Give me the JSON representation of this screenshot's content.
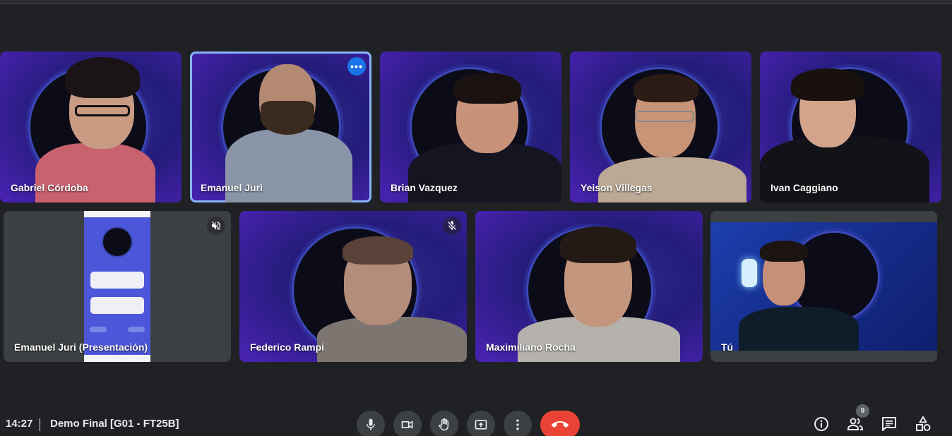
{
  "meeting": {
    "time": "14:27",
    "title": "Demo Final [G01 - FT25B]",
    "participant_count": "9"
  },
  "tiles": [
    {
      "name": "Gabriel Córdoba"
    },
    {
      "name": "Emanuel Juri"
    },
    {
      "name": "Brian Vazquez"
    },
    {
      "name": "Yeison Villegas"
    },
    {
      "name": "Ivan Caggiano"
    },
    {
      "name": "Emanuel Juri (Presentación)"
    },
    {
      "name": "Federico Rampi"
    },
    {
      "name": "Maximiliano Rocha"
    },
    {
      "name": "Tú"
    }
  ],
  "icons": {
    "more": "more-horizontal-icon",
    "muted": "mic-off-icon",
    "volume_off": "volume-off-icon",
    "mic": "mic-icon",
    "camera": "videocam-icon",
    "hand": "raise-hand-icon",
    "present": "present-screen-icon",
    "options": "more-vertical-icon",
    "hangup": "call-end-icon",
    "info": "info-icon",
    "people": "people-icon",
    "chat": "chat-icon",
    "activities": "activities-icon"
  },
  "colors": {
    "background": "#202124",
    "control": "#3c4043",
    "hangup": "#ea4335",
    "active_outline": "#8ab4f8",
    "accent": "#1a73e8"
  }
}
